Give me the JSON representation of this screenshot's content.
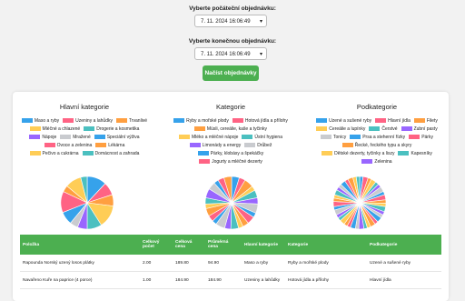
{
  "form": {
    "start_label": "Vyberte počáteční objednávku:",
    "start_value": "7. 11. 2024 16:06:49",
    "end_label": "Vyberte konečnou objednávku:",
    "end_value": "7. 11. 2024 16:06:49",
    "load_button": "Načíst objednávky"
  },
  "charts": [
    {
      "title": "Hlavní kategorie",
      "legend": [
        {
          "label": "Maso a ryby",
          "color": "#36a2eb"
        },
        {
          "label": "Uzeniny a lahůdky",
          "color": "#ff6384"
        },
        {
          "label": "Trvanlivé",
          "color": "#ff9f40"
        },
        {
          "label": "Mléčné a chlazené",
          "color": "#ffcd56"
        },
        {
          "label": "Drogerie a kosmetika",
          "color": "#4bc0c0"
        },
        {
          "label": "Nápoje",
          "color": "#9966ff"
        },
        {
          "label": "Mražené",
          "color": "#c9cbcf"
        },
        {
          "label": "Speciální výživa",
          "color": "#36a2eb"
        },
        {
          "label": "Ovoce a zelenina",
          "color": "#ff6384"
        },
        {
          "label": "Lékárna",
          "color": "#ff9f40"
        },
        {
          "label": "Pečivo a cukrárna",
          "color": "#ffcd56"
        },
        {
          "label": "Domácnost a zahrada",
          "color": "#4bc0c0"
        }
      ],
      "slices": [
        12,
        8,
        7,
        14,
        9,
        6,
        5,
        8,
        13,
        4,
        10,
        4
      ]
    },
    {
      "title": "Kategorie",
      "legend": [
        {
          "label": "Ryby a mořské plody",
          "color": "#36a2eb"
        },
        {
          "label": "Hotová jídla a přílohy",
          "color": "#ff6384"
        },
        {
          "label": "Müsli, cereálie, kaše a tyčinky",
          "color": "#ff9f40"
        },
        {
          "label": "Mléko a mléčné nápoje",
          "color": "#ffcd56"
        },
        {
          "label": "Ústní hygiena",
          "color": "#4bc0c0"
        },
        {
          "label": "Limonády a energy",
          "color": "#9966ff"
        },
        {
          "label": "Drůbež",
          "color": "#c9cbcf"
        },
        {
          "label": "Párky, klobásy a špekáčky",
          "color": "#36a2eb"
        },
        {
          "label": "Jogurty a mléčné dezerty",
          "color": "#ff6384"
        }
      ],
      "slices": [
        5,
        4,
        6,
        3,
        5,
        4,
        6,
        3,
        5,
        4,
        3,
        5,
        4,
        6,
        3,
        4,
        5,
        3,
        4,
        6,
        5,
        3,
        4,
        5
      ]
    },
    {
      "title": "Podkategorie",
      "legend": [
        {
          "label": "Uzené a sušené ryby",
          "color": "#36a2eb"
        },
        {
          "label": "Hlavní jídla",
          "color": "#ff6384"
        },
        {
          "label": "Filety",
          "color": "#ff9f40"
        },
        {
          "label": "Cereálie a lupínky",
          "color": "#ffcd56"
        },
        {
          "label": "Čerstvé",
          "color": "#4bc0c0"
        },
        {
          "label": "Zubní pasty",
          "color": "#9966ff"
        },
        {
          "label": "Tonicy",
          "color": "#c9cbcf"
        },
        {
          "label": "Prsa a stehenní řízky",
          "color": "#36a2eb"
        },
        {
          "label": "Párky",
          "color": "#ff6384"
        },
        {
          "label": "Řecké, řeckého typu a skyry",
          "color": "#ff9f40"
        },
        {
          "label": "Dětské dezerty, tyčinky a liszy",
          "color": "#ffcd56"
        },
        {
          "label": "Kapesníky",
          "color": "#4bc0c0"
        },
        {
          "label": "Zelenina",
          "color": "#9966ff"
        }
      ],
      "slices": [
        2,
        3,
        2,
        3,
        2,
        2,
        3,
        2,
        3,
        2,
        2,
        3,
        2,
        2,
        3,
        2,
        3,
        2,
        2,
        3,
        2,
        3,
        2,
        2,
        3,
        2,
        2,
        3,
        2,
        3,
        2,
        2,
        3,
        2,
        2,
        3,
        2,
        3,
        2,
        2
      ]
    }
  ],
  "palette": [
    "#36a2eb",
    "#ff6384",
    "#ff9f40",
    "#ffcd56",
    "#4bc0c0",
    "#9966ff",
    "#c9cbcf"
  ],
  "table": {
    "headers": [
      "Položka",
      "Celkový počet",
      "Celková cena",
      "Průměrná cena",
      "Hlavní kategorie",
      "Kategorie",
      "Podkategorie"
    ],
    "rows": [
      [
        "Rapounda Norský uzený losos plátky",
        "2.00",
        "189.80",
        "94.90",
        "Maso a ryby",
        "Ryby a mořské plody",
        "Uzené a sušené ryby"
      ],
      [
        "Navařeno Kuře na paprice (4 porce)",
        "1.00",
        "184.90",
        "184.90",
        "Uzeniny a lahůdky",
        "Hotová jídla a přílohy",
        "Hlavní jídla"
      ]
    ]
  }
}
